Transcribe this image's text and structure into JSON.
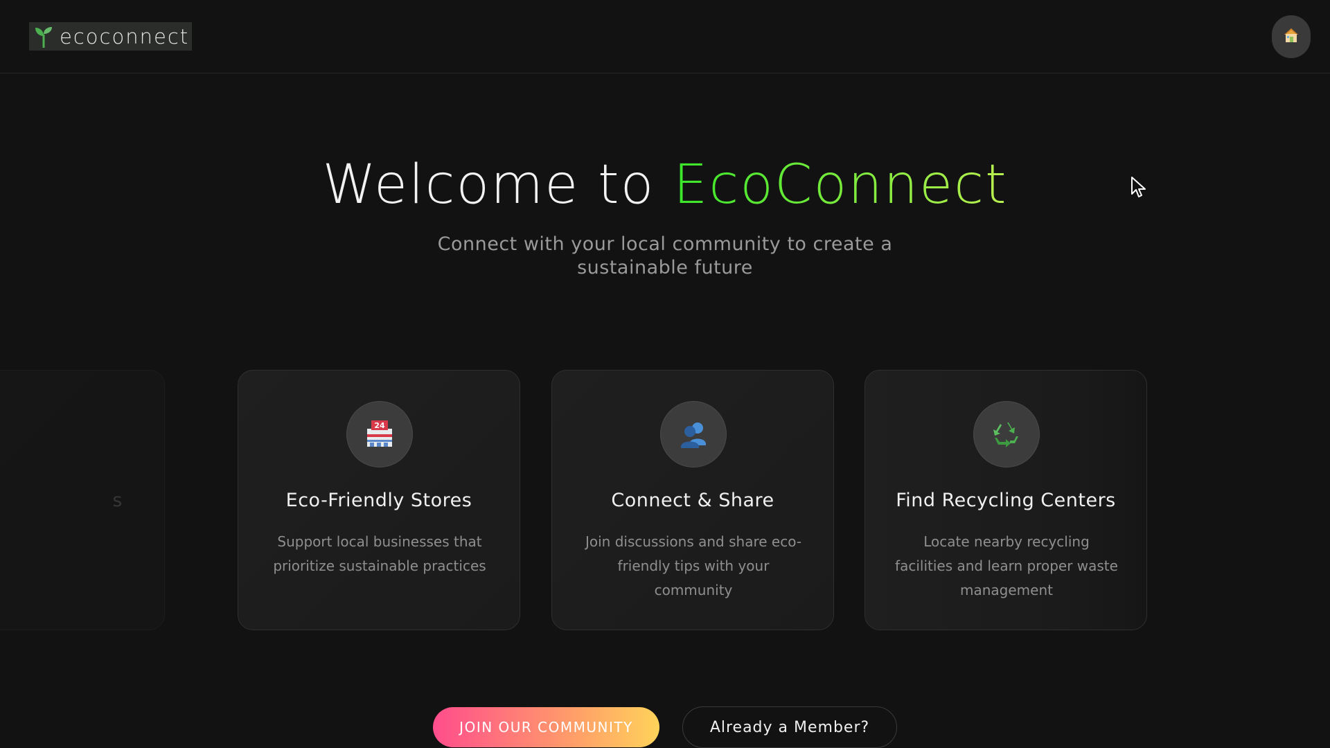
{
  "header": {
    "logo_text": "ecoconnect",
    "logo_icon": "seedling-icon",
    "home_icon": "house-icon"
  },
  "hero": {
    "title_prefix": "Welcome to",
    "title_brand": "EcoConnect",
    "subtitle": "Connect with your local community to create a sustainable future"
  },
  "features": {
    "partial_title": "s",
    "items": [
      {
        "icon": "store-24-icon",
        "title": "Eco-Friendly Stores",
        "description": "Support local businesses that prioritize sustainable practices"
      },
      {
        "icon": "people-icon",
        "title": "Connect & Share",
        "description": "Join discussions and share eco-friendly tips with your community"
      },
      {
        "icon": "recycle-icon",
        "title": "Find Recycling Centers",
        "description": "Locate nearby recycling facilities and learn proper waste management"
      }
    ]
  },
  "cta": {
    "join_label": "JOIN OUR COMMUNITY",
    "member_label": "Already a Member?"
  },
  "colors": {
    "background": "#121212",
    "brand_gradient_start": "#39e62a",
    "brand_gradient_end": "#b9ef4f",
    "cta_gradient_start": "#ff4d8d",
    "cta_gradient_end": "#ffd35a"
  }
}
